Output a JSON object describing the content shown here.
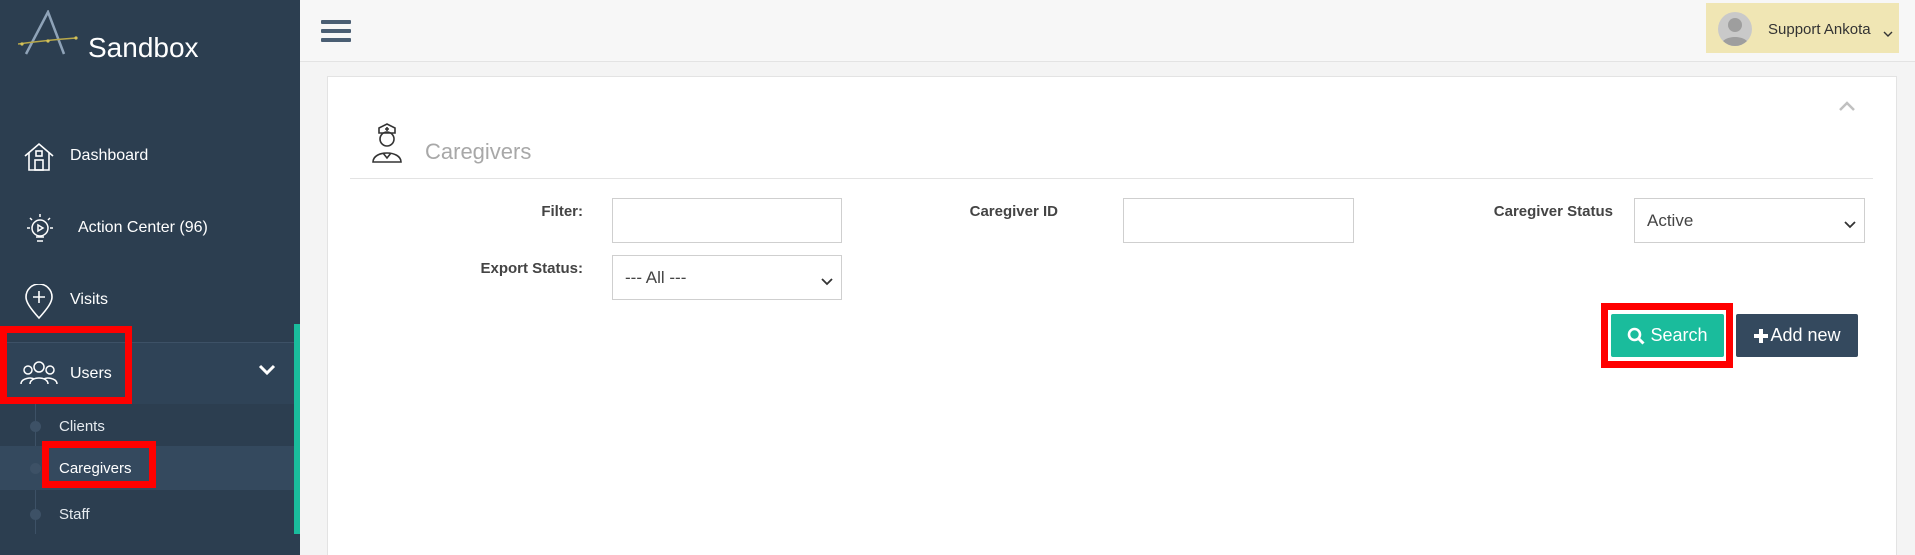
{
  "app": {
    "brand": "Sandbox"
  },
  "sidebar": {
    "items": [
      {
        "label": "Dashboard",
        "icon": "home-icon"
      },
      {
        "label": "Action Center (96)",
        "icon": "lightbulb-icon"
      },
      {
        "label": "Visits",
        "icon": "location-plus-icon"
      },
      {
        "label": "Users",
        "icon": "users-icon"
      }
    ],
    "users_submenu": [
      {
        "label": "Clients"
      },
      {
        "label": "Caregivers",
        "active": true
      },
      {
        "label": "Staff"
      }
    ]
  },
  "header": {
    "user_name": "Support Ankota"
  },
  "panel": {
    "title": "Caregivers",
    "filters": {
      "filter_label": "Filter:",
      "filter_value": "",
      "caregiver_id_label": "Caregiver ID",
      "caregiver_id_value": "",
      "caregiver_status_label": "Caregiver Status",
      "caregiver_status_value": "Active",
      "export_status_label": "Export Status:",
      "export_status_value": "--- All ---"
    },
    "buttons": {
      "search": "Search",
      "add_new": "Add new"
    }
  },
  "colors": {
    "sidebar_bg": "#2c3e50",
    "accent": "#1abc9c",
    "highlight": "#ff0000",
    "user_menu_bg": "#f0e6b4",
    "add_button": "#34495e"
  }
}
